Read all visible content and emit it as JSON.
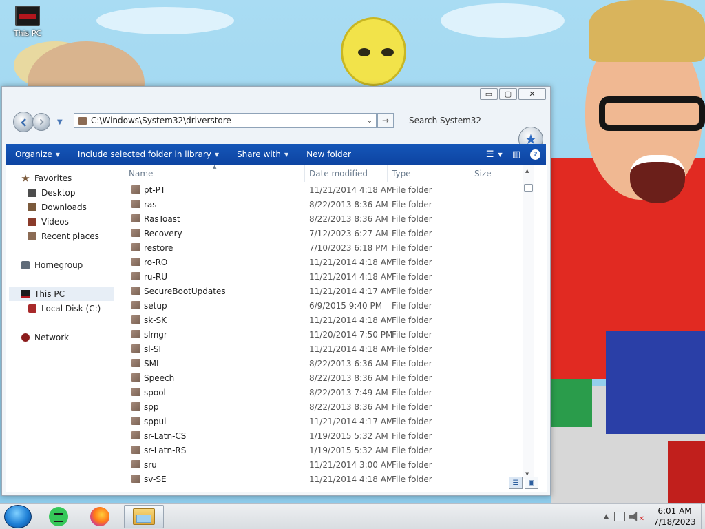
{
  "desktop": {
    "icon_label": "This PC"
  },
  "window": {
    "controls": {
      "minimize": "▭",
      "maximize": "▢",
      "close": "✕"
    },
    "address_path": "C:\\Windows\\System32\\driverstore",
    "search_placeholder": "Search System32"
  },
  "toolbar": {
    "organize": "Organize",
    "include": "Include selected folder in library",
    "share": "Share with",
    "new_folder": "New folder"
  },
  "sidebar": {
    "favorites": "Favorites",
    "items": [
      "Desktop",
      "Downloads",
      "Videos",
      "Recent places"
    ],
    "homegroup": "Homegroup",
    "this_pc": "This PC",
    "local_disk": "Local Disk (C:)",
    "network": "Network"
  },
  "columns": {
    "name": "Name",
    "date": "Date modified",
    "type": "Type",
    "size": "Size"
  },
  "files": [
    {
      "name": "pt-PT",
      "date": "11/21/2014 4:18 AM",
      "type": "File folder"
    },
    {
      "name": "ras",
      "date": "8/22/2013 8:36 AM",
      "type": "File folder"
    },
    {
      "name": "RasToast",
      "date": "8/22/2013 8:36 AM",
      "type": "File folder"
    },
    {
      "name": "Recovery",
      "date": "7/12/2023 6:27 AM",
      "type": "File folder"
    },
    {
      "name": "restore",
      "date": "7/10/2023 6:18 PM",
      "type": "File folder"
    },
    {
      "name": "ro-RO",
      "date": "11/21/2014 4:18 AM",
      "type": "File folder"
    },
    {
      "name": "ru-RU",
      "date": "11/21/2014 4:18 AM",
      "type": "File folder"
    },
    {
      "name": "SecureBootUpdates",
      "date": "11/21/2014 4:17 AM",
      "type": "File folder"
    },
    {
      "name": "setup",
      "date": "6/9/2015 9:40 PM",
      "type": "File folder"
    },
    {
      "name": "sk-SK",
      "date": "11/21/2014 4:18 AM",
      "type": "File folder"
    },
    {
      "name": "slmgr",
      "date": "11/20/2014 7:50 PM",
      "type": "File folder"
    },
    {
      "name": "sl-SI",
      "date": "11/21/2014 4:18 AM",
      "type": "File folder"
    },
    {
      "name": "SMI",
      "date": "8/22/2013 6:36 AM",
      "type": "File folder"
    },
    {
      "name": "Speech",
      "date": "8/22/2013 8:36 AM",
      "type": "File folder"
    },
    {
      "name": "spool",
      "date": "8/22/2013 7:49 AM",
      "type": "File folder"
    },
    {
      "name": "spp",
      "date": "8/22/2013 8:36 AM",
      "type": "File folder"
    },
    {
      "name": "sppui",
      "date": "11/21/2014 4:17 AM",
      "type": "File folder"
    },
    {
      "name": "sr-Latn-CS",
      "date": "1/19/2015 5:32 AM",
      "type": "File folder"
    },
    {
      "name": "sr-Latn-RS",
      "date": "1/19/2015 5:32 AM",
      "type": "File folder"
    },
    {
      "name": "sru",
      "date": "11/21/2014 3:00 AM",
      "type": "File folder"
    },
    {
      "name": "sv-SE",
      "date": "11/21/2014 4:18 AM",
      "type": "File folder"
    }
  ],
  "taskbar": {
    "time": "6:01 AM",
    "date": "7/18/2023"
  }
}
